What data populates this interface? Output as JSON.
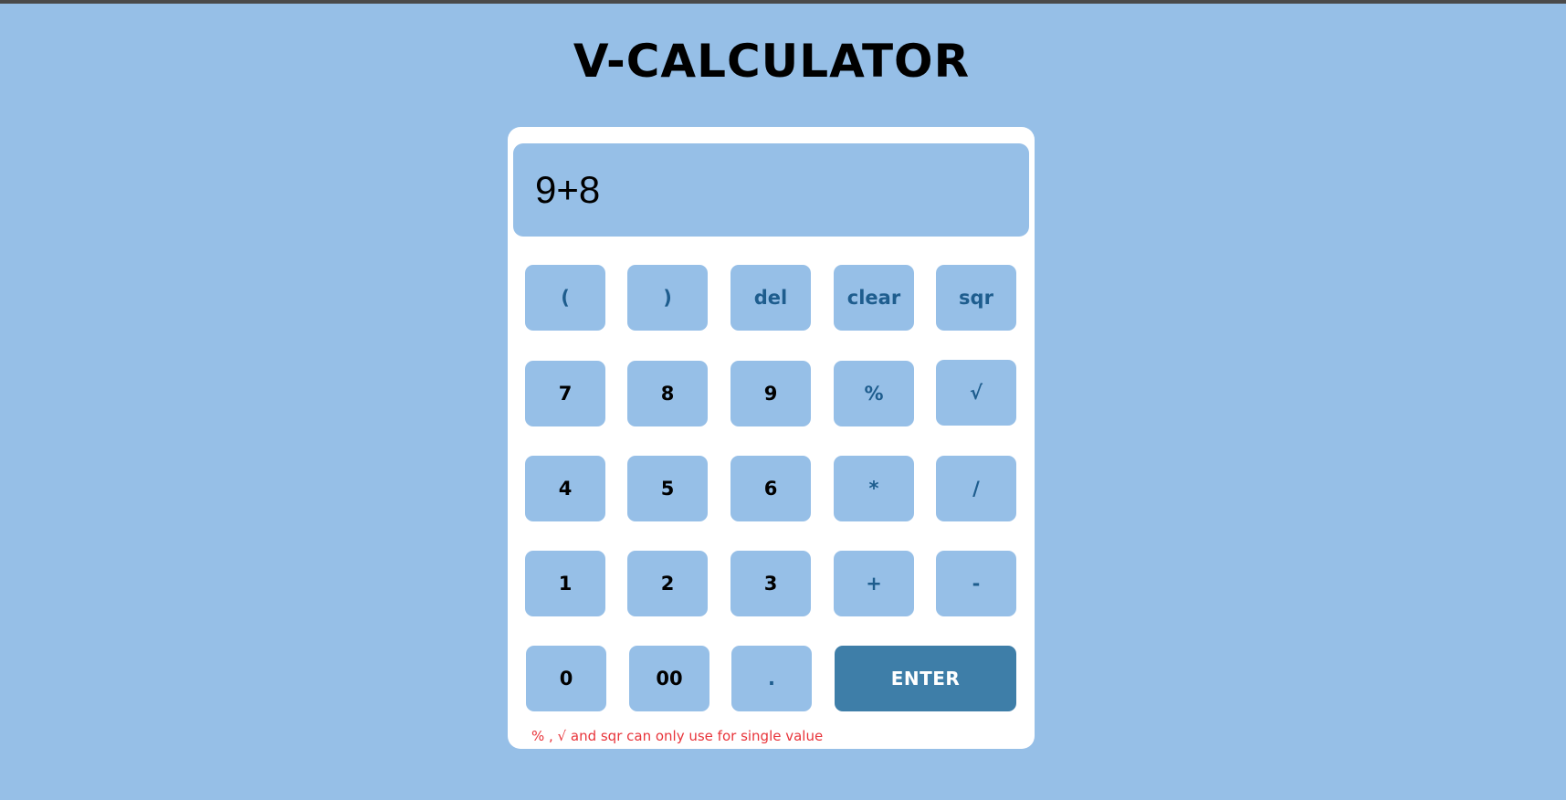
{
  "app": {
    "title": "V-CALCULATOR"
  },
  "display": {
    "value": "9+8"
  },
  "keys": {
    "open_paren": "(",
    "close_paren": ")",
    "del": "del",
    "clear": "clear",
    "sqr": "sqr",
    "seven": "7",
    "eight": "8",
    "nine": "9",
    "percent": "%",
    "sqrt": "√",
    "four": "4",
    "five": "5",
    "six": "6",
    "multiply": "*",
    "divide": "/",
    "one": "1",
    "two": "2",
    "three": "3",
    "plus": "+",
    "minus": "-",
    "zero": "0",
    "double_zero": "00",
    "dot": ".",
    "enter": "ENTER"
  },
  "note": "% , √ and sqr can only use for single value",
  "colors": {
    "background": "#96bfe7",
    "card": "#ffffff",
    "key": "#96bfe7",
    "operator_text": "#1e5d8e",
    "enter_button": "#3e7ea8",
    "note_text": "#e8343a"
  }
}
